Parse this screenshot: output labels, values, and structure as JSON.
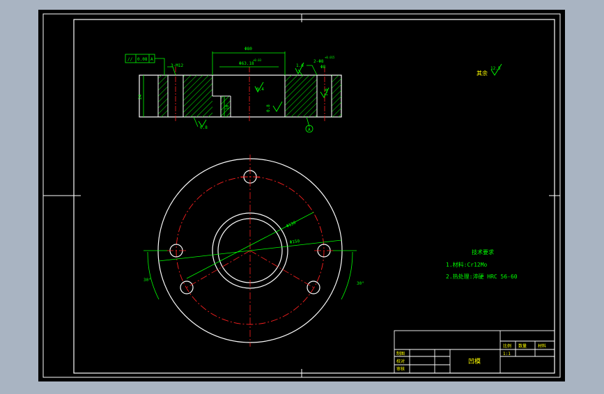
{
  "colors": {
    "window_bg": "#a9b4c2",
    "paper": "#000000",
    "frame": "#ffffff",
    "dimension": "#00ff00",
    "centerline": "#ff2020",
    "text": "#00ff00",
    "title_text": "#ffff00"
  },
  "section_view": {
    "flatness_tol": "//",
    "flatness_value": "0.08",
    "datum_ref": "A",
    "dim_top_width": "Φ80",
    "dim_bore": "Φ63.18",
    "dim_bore_tol": "+0.03",
    "dim_hole_pattern": "3-M12",
    "dim_right_holes": "2-Φ8",
    "dim_right_tol": "+0.015",
    "dim_right_depth": "Φ8",
    "roughness_top": "1.6",
    "roughness_bore": "0.4",
    "roughness_face": "0.8",
    "roughness_bottom": "0.8",
    "roughness_side": "1.6",
    "dim_height": "24",
    "dim_inner": "10",
    "datum_label": "A"
  },
  "plan_view": {
    "dim_pcd1": "Φ130",
    "dim_pcd2": "Φ150",
    "angle_left": "30°",
    "angle_right": "30°"
  },
  "general_roughness": {
    "label": "其余",
    "value": "12.5"
  },
  "tech_requirements": {
    "title": "技术要求",
    "item1": "1.材料:Cr12Mo",
    "item2": "2.热处理:淬硬 HRC 56-60"
  },
  "title_block": {
    "part_name": "凹模",
    "scale_header": "比例",
    "qty_header": "数量",
    "material_header": "材料",
    "scale_value": "1:1",
    "designer": "制图",
    "checker": "校对",
    "approver": "审核"
  }
}
